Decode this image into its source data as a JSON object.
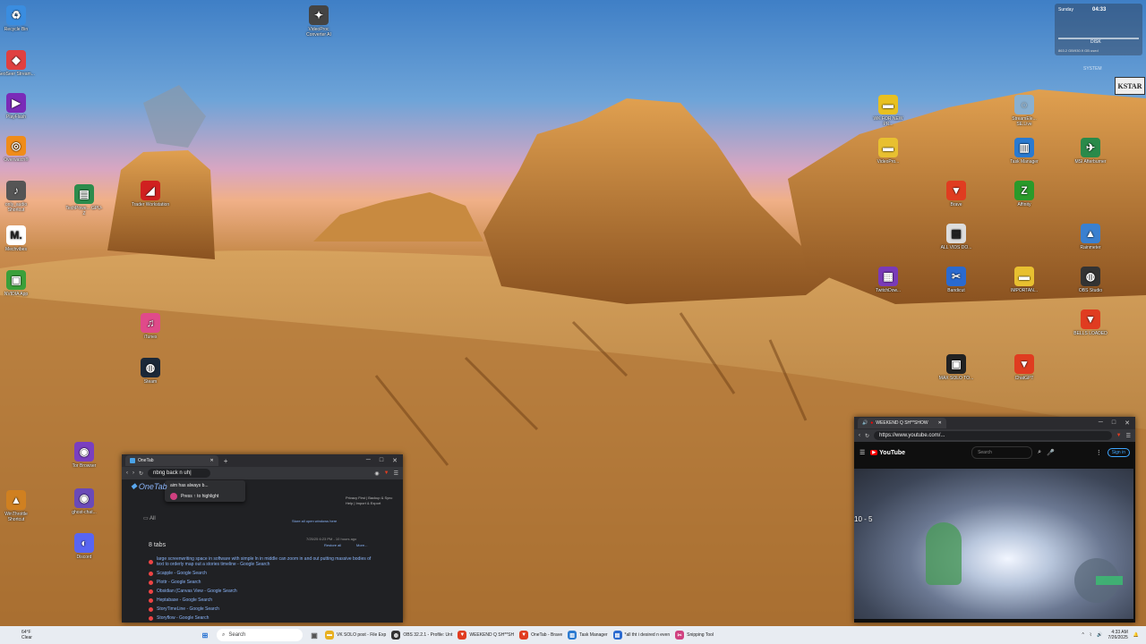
{
  "desktop": {
    "left_icons": [
      {
        "label": "Recycle Bin",
        "color": "#3a8de0",
        "glyph": "♻"
      },
      {
        "label": "GeoSeer Stream...",
        "color": "#e04040",
        "glyph": "◆"
      },
      {
        "label": "PlayFlash",
        "color": "#7a2bb8",
        "glyph": "▶"
      },
      {
        "label": "Overwatch®",
        "color": "#f08c1a",
        "glyph": "◎"
      },
      {
        "label": "only_audio Shortcut",
        "color": "#555555",
        "glyph": "♪"
      },
      {
        "label": "Mechvibes",
        "color": "#ffffff",
        "glyph": "M."
      },
      {
        "label": "NVIDIA App",
        "color": "#3aa03a",
        "glyph": "▣"
      },
      {
        "label": "Tor Browser",
        "color": "#7a3fc0",
        "glyph": "◉"
      },
      {
        "label": "ghost-chat...",
        "color": "#6a4ab8",
        "glyph": "◉"
      },
      {
        "label": "WinThrottle Shortcut",
        "color": "#d08020",
        "glyph": "▲"
      },
      {
        "label": "Discord",
        "color": "#5865f2",
        "glyph": "◐"
      }
    ],
    "mid_icons": [
      {
        "label": "TechPowe... GPU-Z",
        "color": "#2c8c4c",
        "glyph": "▤"
      },
      {
        "label": "Trader Workstation",
        "color": "#d02020",
        "glyph": "◢"
      },
      {
        "label": "iTunes",
        "color": "#e04a8a",
        "glyph": "♫"
      },
      {
        "label": "Steam",
        "color": "#1b2838",
        "glyph": "◍"
      },
      {
        "label": "VideoProc Converter AI",
        "color": "#444444",
        "glyph": "✦"
      }
    ],
    "right_icons": [
      {
        "label": "WK FOR NEW PR...",
        "color": "#e8c020",
        "glyph": "▬"
      },
      {
        "label": "VideoPro...",
        "color": "#e8c030",
        "glyph": "▬"
      },
      {
        "label": "StreamEle... SE.Live",
        "color": "#8ab0d0",
        "glyph": "◌"
      },
      {
        "label": "Task Manager",
        "color": "#2a7ad0",
        "glyph": "▥"
      },
      {
        "label": "MSI Afterburner",
        "color": "#2a8a4a",
        "glyph": "✈"
      },
      {
        "label": "Brave",
        "color": "#e03c20",
        "glyph": "▼"
      },
      {
        "label": "Affinity",
        "color": "#2a9a2a",
        "glyph": "Z"
      },
      {
        "label": "ALL VIDS DO...",
        "color": "#dddddd",
        "glyph": "▤"
      },
      {
        "label": "Rainmeter",
        "color": "#3a80d0",
        "glyph": "▲"
      },
      {
        "label": "TwitchDow...",
        "color": "#7a3ab8",
        "glyph": "▦"
      },
      {
        "label": "Bandicut",
        "color": "#2a6ad0",
        "glyph": "✂"
      },
      {
        "label": "IMPORTAN...",
        "color": "#e8c030",
        "glyph": "▬"
      },
      {
        "label": "OBS Studio",
        "color": "#333333",
        "glyph": "◍"
      },
      {
        "label": "BELLS LOADED",
        "color": "#e03c20",
        "glyph": "▼"
      },
      {
        "label": "MAX SOLO TO...",
        "color": "#222222",
        "glyph": "▣"
      },
      {
        "label": "ChatGPT",
        "color": "#e03c20",
        "glyph": "▼"
      }
    ]
  },
  "widget": {
    "time": "04:33",
    "day": "Sunday",
    "disk_label": "DISK",
    "disk_info": "863.2 GB/930.9 GB used",
    "system_label": "SYSTEM",
    "brand": "KSTAR"
  },
  "onetab_window": {
    "tab_title": "OneTab",
    "new_tab": "+",
    "controls": [
      "─",
      "□",
      "✕"
    ],
    "url_text": "nbng back n uh|",
    "suggestion_1": "aim has always b...",
    "suggestion_2": "Press ↑ to highlight",
    "brand": "OneTab",
    "all_label": "All",
    "links": [
      "Privacy First",
      "Backup & Sync",
      "Help",
      "Import & Export"
    ],
    "store_note": "Store all open windows here",
    "restore_all": "Restore all",
    "more": "More...",
    "tab_count": "8 tabs",
    "created": "7/25/25 6:23 PM - 10 hours ago",
    "tabs": [
      "large screenwriting space in software with simple ln in middle can zoom in and out putting massive bodies of text to orderly map out a stories timeline - Google Search",
      "Scapple - Google Search",
      "Plottr - Google Search",
      "Obsidian (Canvas View - Google Search",
      "Heptabase - Google Search",
      "StoryTimeLine - Google Search",
      "Storyflow - Google Search"
    ]
  },
  "youtube_window": {
    "tab_title": "WEEKEND Q SH**SHOW",
    "url": "https://www.youtube.com/...",
    "logo": "YouTube",
    "search_placeholder": "Search",
    "sign_in": "Sign in",
    "score": "10 - 5"
  },
  "taskbar": {
    "search_placeholder": "Search",
    "apps": [
      {
        "label": "VK SOLO post - File Exp",
        "color": "#e8b020",
        "glyph": "▬"
      },
      {
        "label": "OBS 32.2.1 - Profile: Unt",
        "color": "#333333",
        "glyph": "◍"
      },
      {
        "label": "WEEKEND Q SH**SH",
        "color": "#e03c20",
        "glyph": "▼"
      },
      {
        "label": "OneTab - Brave",
        "color": "#e03c20",
        "glyph": "▼"
      },
      {
        "label": "Task Manager",
        "color": "#2a7ad0",
        "glyph": "▥"
      },
      {
        "label": "*all tht i desired n even",
        "color": "#2a6ad0",
        "glyph": "▤"
      },
      {
        "label": "Snipping Tool",
        "color": "#d04080",
        "glyph": "✂"
      }
    ],
    "time": "4:33 AM",
    "date": "7/26/2025",
    "weather_temp": "64°F",
    "weather_text": "Clear"
  }
}
